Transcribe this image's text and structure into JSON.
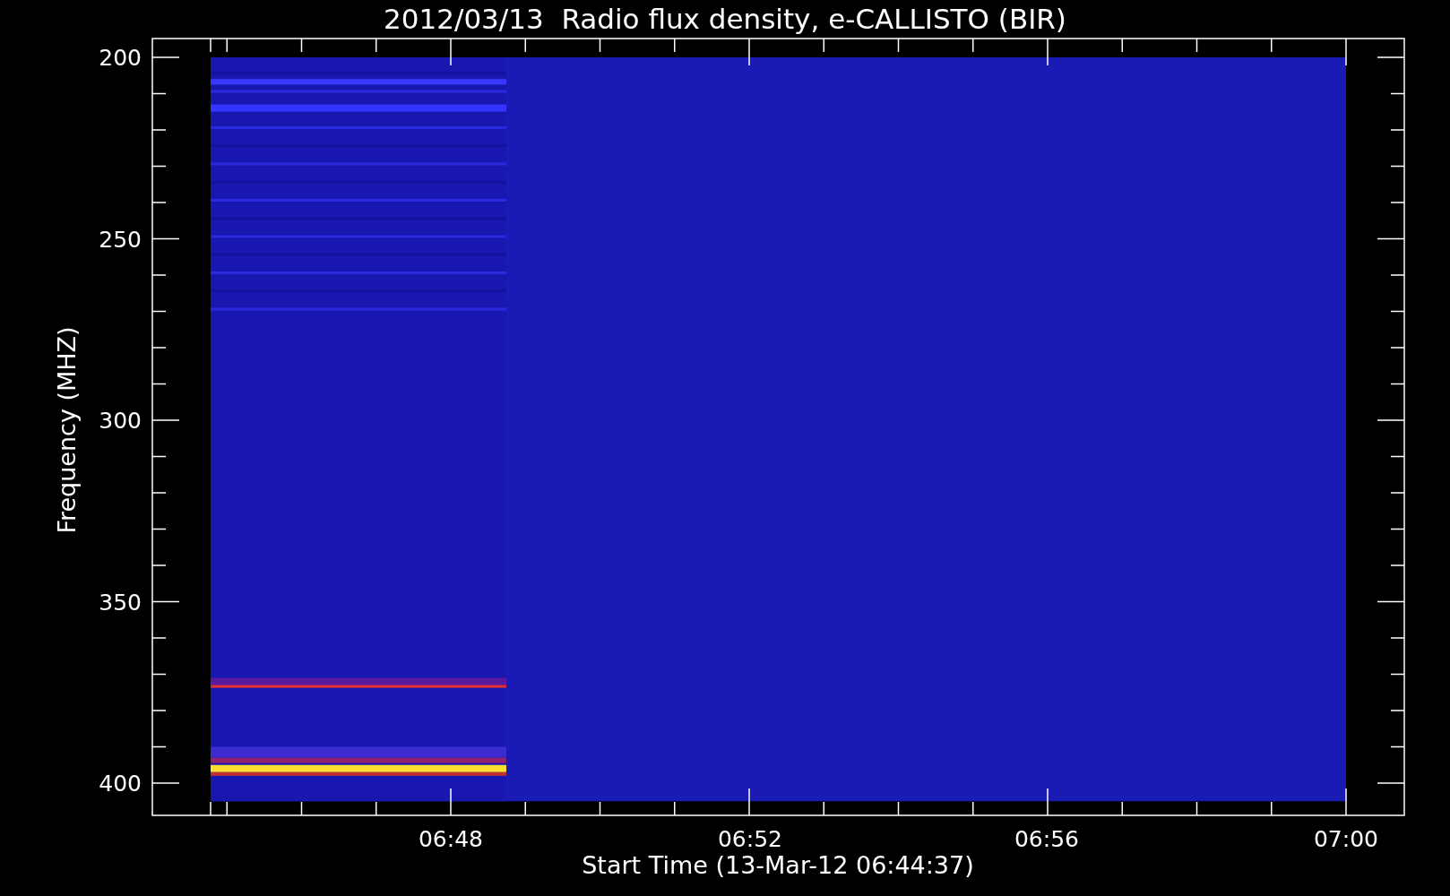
{
  "title": "2012/03/13  Radio flux density, e-CALLISTO (BIR)",
  "y_axis": {
    "label": "Frequency (MHZ)",
    "ticks": [
      "200",
      "250",
      "300",
      "350",
      "400"
    ]
  },
  "x_axis": {
    "label": "Start Time (13-Mar-12 06:44:37)",
    "ticks": [
      "06:48",
      "06:52",
      "06:56",
      "07:00"
    ]
  }
}
